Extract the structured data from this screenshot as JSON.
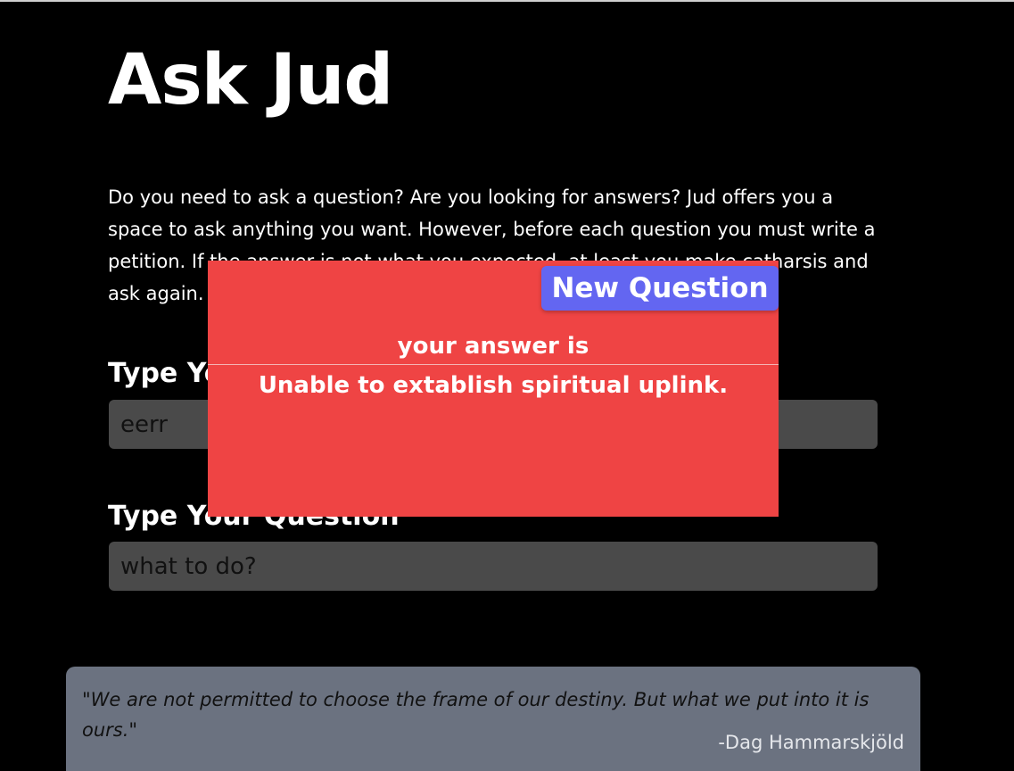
{
  "app": {
    "title": "Ask Jud",
    "intro": "Do you need to ask a question? Are you looking for answers? Jud offers you a space to ask anything you want. However, before each question you must write a petition. If the answer is not what you expected, at least you make catharsis and ask again."
  },
  "form": {
    "petition_label": "Type Your Petition",
    "petition_value": "eerr",
    "question_label": "Type Your Question",
    "question_value": "what to do?"
  },
  "modal": {
    "new_question_label": "New Question",
    "answer_heading": "your answer is",
    "answer_text": "Unable to extablish spiritual uplink."
  },
  "quote": {
    "text": "\"We are not permitted to choose the frame of our destiny. But what we put into it is ours.\"",
    "author": "-Dag Hammarskjöld"
  },
  "colors": {
    "background": "#000000",
    "modal": "#ef4444",
    "button": "#6366f1",
    "input": "#4a4a4a",
    "quote_box": "#6b7280"
  }
}
